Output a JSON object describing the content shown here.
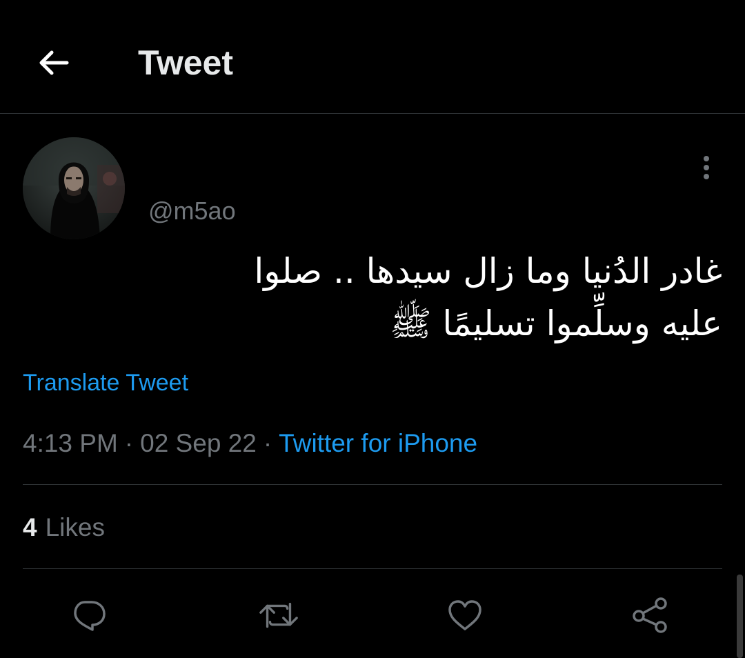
{
  "header": {
    "title": "Tweet",
    "back_icon": "arrow-left-icon"
  },
  "tweet": {
    "author": {
      "handle": "@m5ao",
      "avatar_icon": "profile-photo"
    },
    "text_lines": [
      "غادر الدُنيا وما زال سيدها .. صلوا",
      "عليه وسلِّموا تسليمًا ﷺ"
    ],
    "translate_label": "Translate Tweet",
    "time": "4:13 PM",
    "date": "02 Sep 22",
    "separator": "·",
    "source": "Twitter for iPhone",
    "likes_count": "4",
    "likes_label": "Likes"
  },
  "actions": [
    {
      "name": "reply",
      "icon": "comment-icon"
    },
    {
      "name": "retweet",
      "icon": "retweet-icon"
    },
    {
      "name": "like",
      "icon": "heart-icon"
    },
    {
      "name": "share",
      "icon": "share-icon"
    }
  ],
  "colors": {
    "background": "#000000",
    "accent": "#1d9bf0",
    "secondary_text": "#71767b",
    "divider": "#2f3336"
  }
}
